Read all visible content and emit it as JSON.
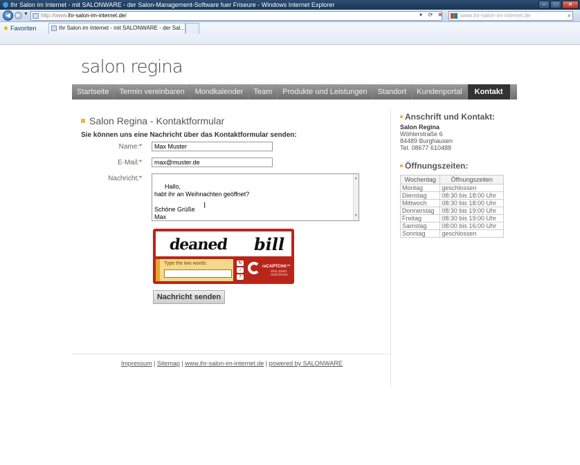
{
  "browser": {
    "title": "Ihr Salon im Internet - mit SALONWARE - der Salon-Management-Software fuer Friseure - Windows Internet Explorer",
    "url_prefix": "http://www.",
    "url_main": "ihr-salon-im-internet.de/",
    "search_placeholder": "www.ihr-salon-im-internet.de",
    "favorites_label": "Favoriten",
    "tab_title": "Ihr Salon im Internet - mit SALONWARE - der Sal..."
  },
  "site": {
    "logo": "salon regina",
    "nav": [
      "Startseite",
      "Termin vereinbaren",
      "Mondkalender",
      "Team",
      "Produkte und Leistungen",
      "Standort",
      "Kundenportal",
      "Kontakt"
    ],
    "active_nav": "Kontakt"
  },
  "contact_form": {
    "title": "Salon Regina - Kontaktformular",
    "intro": "Sie können uns eine Nachricht über das Kontaktformular senden:",
    "name_label": "Name:",
    "name_value": "Max Muster",
    "email_label": "E-Mail:",
    "email_value": "max@muster.de",
    "message_label": "Nachricht:",
    "message_value": "Hallo,\nhabt ihr an Weihnachten geöffnet?\n\nSchöne Grüße\nMax",
    "required_marker": "*",
    "submit_label": "Nachricht senden"
  },
  "captcha": {
    "word1": "deaned",
    "word2": "bill",
    "prompt": "Type the two words:",
    "brand": "reCAPTCHA™",
    "tagline": "stop spam. read books."
  },
  "sidebar": {
    "address_title": "Anschrift und Kontakt:",
    "salon_name": "Salon Regina",
    "street": "Wöhlerstraße 6",
    "city": "84489 Burghausen",
    "phone": "Tel. 08677 610488",
    "hours_title": "Öffnungszeiten:",
    "hours_headers": [
      "Wochentag",
      "Öffnungszeiten"
    ],
    "hours": [
      {
        "day": "Montag",
        "time": "geschlossen"
      },
      {
        "day": "Dienstag",
        "time": "08:30 bis 18:00 Uhr"
      },
      {
        "day": "Mittwoch",
        "time": "08:30 bis 18:00 Uhr"
      },
      {
        "day": "Donnerstag",
        "time": "08:30 bis 19:00 Uhr"
      },
      {
        "day": "Freitag",
        "time": "08:30 bis 19:00 Uhr"
      },
      {
        "day": "Samstag",
        "time": "08:00 bis 16:00 Uhr"
      },
      {
        "day": "Sonntag",
        "time": "geschlossen"
      }
    ]
  },
  "footer": {
    "links": [
      "Impressum",
      "Sitemap",
      "www.ihr-salon-im-internet.de",
      "powered by SALONWARE"
    ],
    "separator": " | "
  },
  "colors": {
    "accent": "#e8b84a",
    "nav_bg": "#7e7e7e",
    "nav_active": "#333333",
    "captcha_red": "#b8261a",
    "required": "#dd2222"
  }
}
